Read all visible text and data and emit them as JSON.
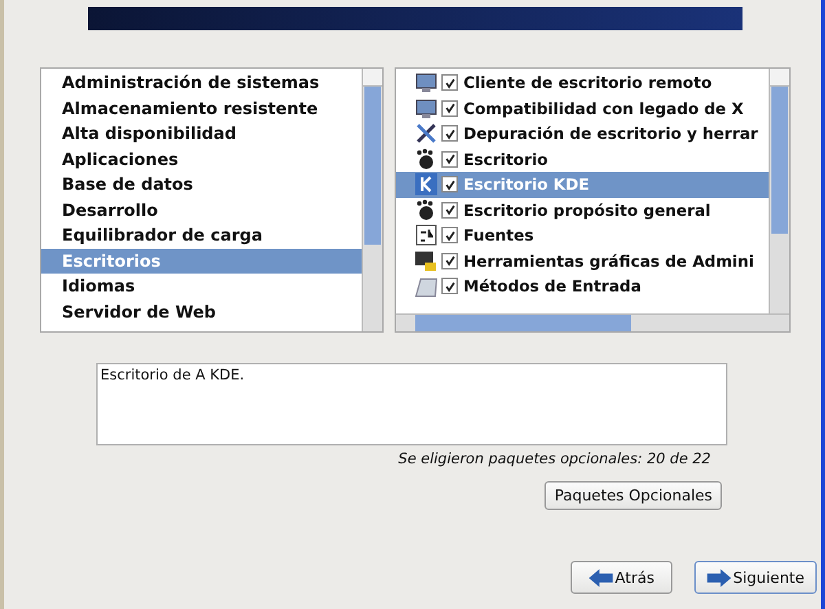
{
  "groups": [
    {
      "label": "Administración de sistemas",
      "selected": false
    },
    {
      "label": "Almacenamiento resistente",
      "selected": false
    },
    {
      "label": "Alta disponibilidad",
      "selected": false
    },
    {
      "label": "Aplicaciones",
      "selected": false
    },
    {
      "label": "Base de datos",
      "selected": false
    },
    {
      "label": "Desarrollo",
      "selected": false
    },
    {
      "label": "Equilibrador de carga",
      "selected": false
    },
    {
      "label": "Escritorios",
      "selected": true
    },
    {
      "label": "Idiomas",
      "selected": false
    },
    {
      "label": "Servidor de Web",
      "selected": false
    }
  ],
  "packages": [
    {
      "label": "Cliente de escritorio remoto",
      "checked": true,
      "selected": false
    },
    {
      "label": "Compatibilidad con legado de X",
      "checked": true,
      "selected": false
    },
    {
      "label": "Depuración de escritorio y herrar",
      "checked": true,
      "selected": false
    },
    {
      "label": "Escritorio",
      "checked": true,
      "selected": false
    },
    {
      "label": "Escritorio KDE",
      "checked": true,
      "selected": true
    },
    {
      "label": "Escritorio propósito general",
      "checked": true,
      "selected": false
    },
    {
      "label": "Fuentes",
      "checked": true,
      "selected": false
    },
    {
      "label": "Herramientas gráficas de Admini",
      "checked": true,
      "selected": false
    },
    {
      "label": "Métodos de Entrada",
      "checked": true,
      "selected": false
    }
  ],
  "description": "Escritorio de A KDE.",
  "summary": "Se eligieron paquetes opcionales: 20 de 22",
  "optional_button": "Paquetes Opcionales",
  "buttons": [
    {
      "label": "Atrás",
      "kind": "back"
    },
    {
      "label": "Siguiente",
      "kind": "next"
    }
  ]
}
